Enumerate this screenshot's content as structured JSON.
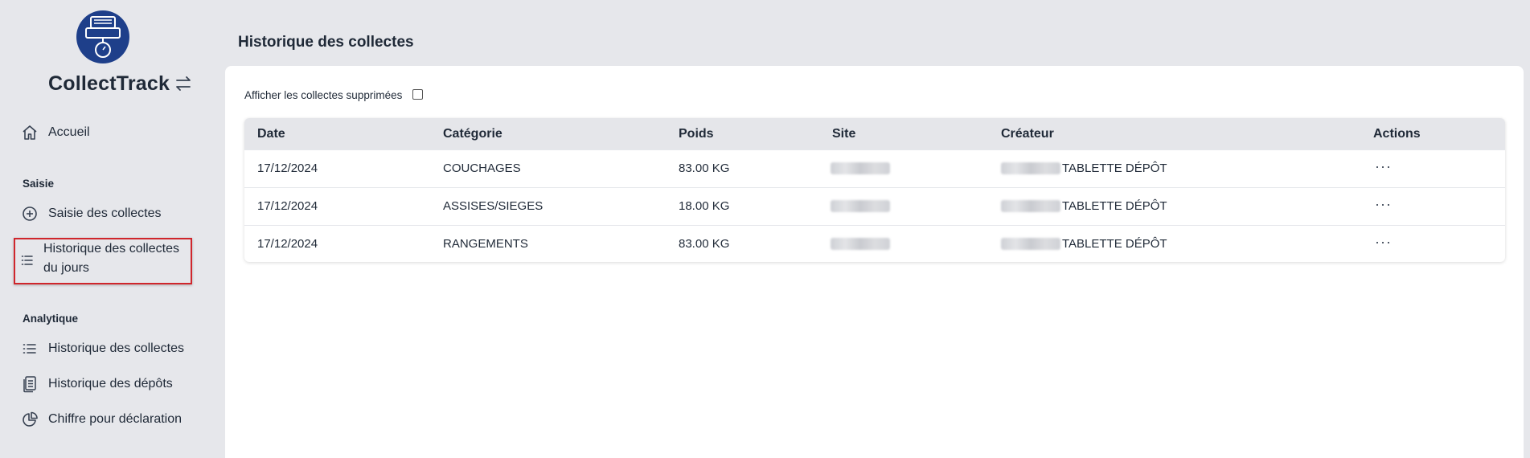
{
  "sidebar": {
    "brand": "CollectTrack",
    "nav": {
      "home": "Accueil",
      "section_saisie": "Saisie",
      "saisie_collectes": "Saisie des collectes",
      "historique_jours": "Historique des collectes du jours",
      "section_analytique": "Analytique",
      "historique_collectes": "Historique des collectes",
      "historique_depots": "Historique des dépôts",
      "chiffre_declaration": "Chiffre pour déclaration"
    }
  },
  "main": {
    "title": "Historique des collectes",
    "show_deleted_label": "Afficher les collectes supprimées",
    "show_deleted_checked": false,
    "table": {
      "headers": {
        "date": "Date",
        "categorie": "Catégorie",
        "poids": "Poids",
        "site": "Site",
        "createur": "Créateur",
        "actions": "Actions"
      },
      "rows": [
        {
          "date": "17/12/2024",
          "categorie": "COUCHAGES",
          "poids": "83.00 KG",
          "createur_suffix": "TABLETTE DÉPÔT",
          "actions": "···"
        },
        {
          "date": "17/12/2024",
          "categorie": "ASSISES/SIEGES",
          "poids": "18.00 KG",
          "createur_suffix": "TABLETTE DÉPÔT",
          "actions": "···"
        },
        {
          "date": "17/12/2024",
          "categorie": "RANGEMENTS",
          "poids": "83.00 KG",
          "createur_suffix": "TABLETTE DÉPÔT",
          "actions": "···"
        }
      ]
    }
  },
  "colors": {
    "accent": "#1e3f8a",
    "highlight_border": "#d0262c",
    "background": "#e6e7eb",
    "table_header": "#e5e6ea"
  },
  "icons": [
    "app-logo-icon",
    "swap-arrows-icon",
    "home-icon",
    "plus-circle-icon",
    "list-icon",
    "clipboard-icon",
    "pie-chart-icon",
    "more-horizontal-icon"
  ]
}
